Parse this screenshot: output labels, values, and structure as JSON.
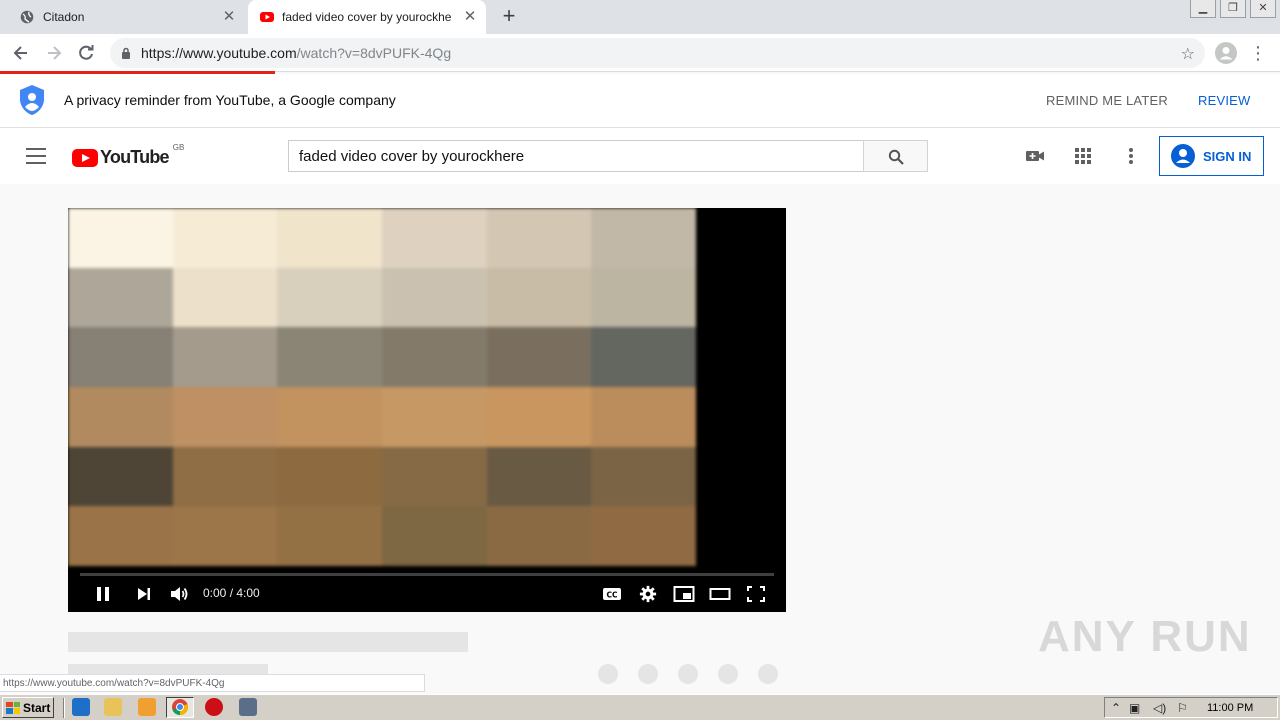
{
  "browser": {
    "tabs": [
      {
        "title": "Citadon",
        "active": false
      },
      {
        "title": "faded video cover by yourockhere -",
        "active": true
      }
    ],
    "url": {
      "host_part": "https://www.youtube.com",
      "path_part": "/watch?v=8dvPUFK-4Qg"
    },
    "status_url": "https://www.youtube.com/watch?v=8dvPUFK-4Qg",
    "new_tab_glyph": "+",
    "close_glyph": "✕"
  },
  "privacy_banner": {
    "message": "A privacy reminder from YouTube, a Google company",
    "remind_later": "REMIND ME LATER",
    "review": "REVIEW"
  },
  "youtube": {
    "logo_text": "YouTube",
    "country_code": "GB",
    "search_value": "faded video cover by yourockhere",
    "sign_in": "SIGN IN"
  },
  "player": {
    "time": "0:00 / 4:00",
    "progress": 0.0,
    "frame_colors": [
      "#fbf4e4",
      "#f6ecd6",
      "#f0e4cb",
      "#ded1bf",
      "#d3c6b3",
      "#c2b8a7",
      "#aea799",
      "#ece0cb",
      "#d8cfbd",
      "#cbc1b0",
      "#c8bca6",
      "#bcb5a2",
      "#868075",
      "#a49b8c",
      "#8b8576",
      "#837a6a",
      "#7a6f5f",
      "#646660",
      "#b18a60",
      "#be9064",
      "#c2925f",
      "#c69864",
      "#c9965f",
      "#bb8d5c",
      "#4e4536",
      "#8f6d45",
      "#8d6a40",
      "#866a45",
      "#695a44",
      "#7b6445",
      "#9a7448",
      "#9c7548",
      "#947045",
      "#7e6743",
      "#8a6a43",
      "#8f6a42"
    ]
  },
  "taskbar": {
    "start_label": "Start",
    "clock": "11:00 PM"
  },
  "watermark": "ANY RUN"
}
